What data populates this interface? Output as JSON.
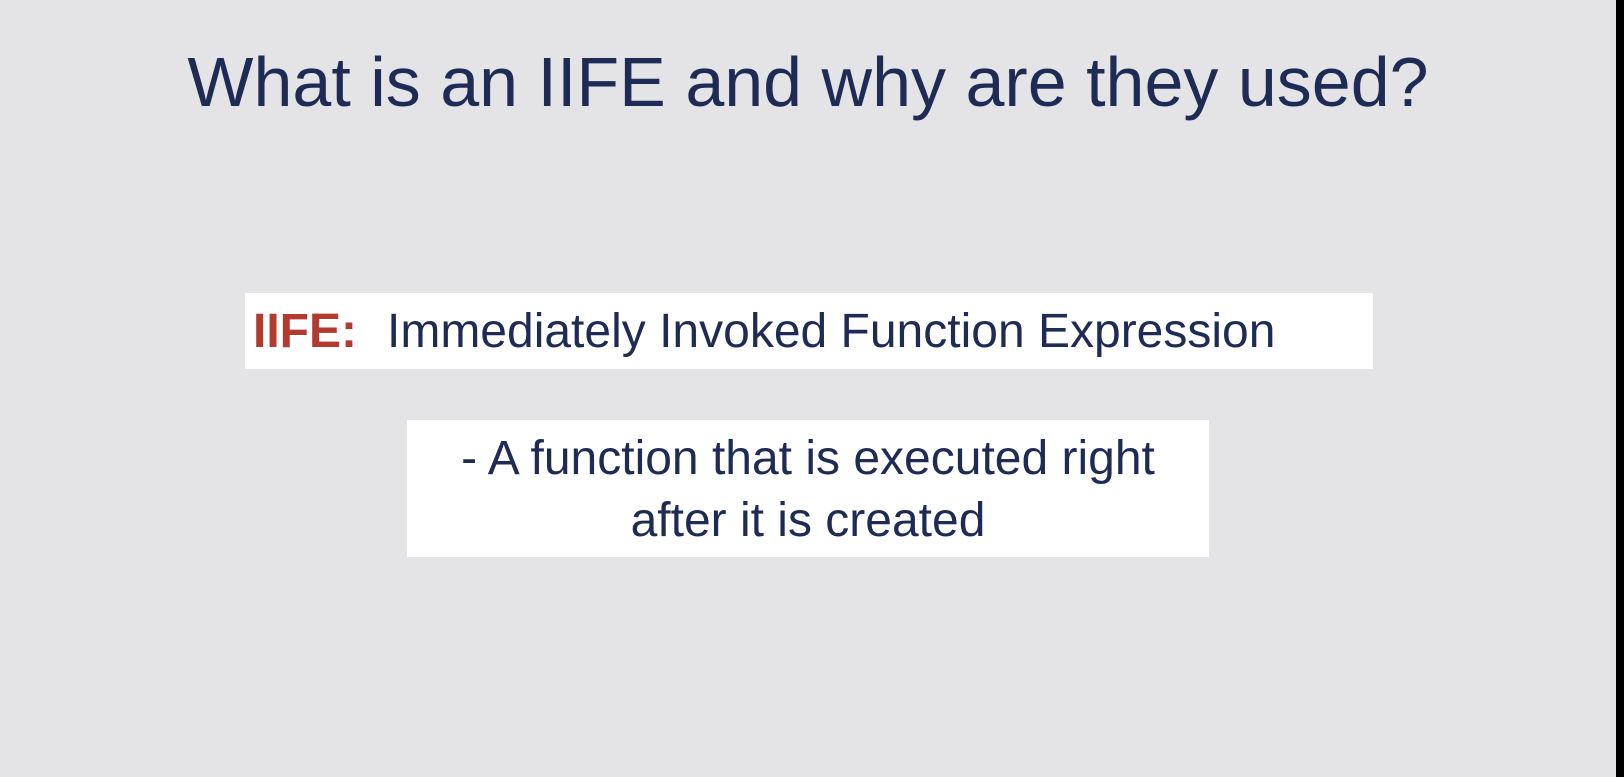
{
  "slide": {
    "title": "What is an IIFE and why are they used?",
    "definition": {
      "term": "IIFE:",
      "text": "Immediately Invoked Function Expression"
    },
    "description": {
      "line1": "- A function that is executed right",
      "line2": "after it is created"
    }
  },
  "colors": {
    "background": "#e4e4e7",
    "title": "#1e2b55",
    "term": "#b23a2e",
    "box": "#ffffff"
  }
}
